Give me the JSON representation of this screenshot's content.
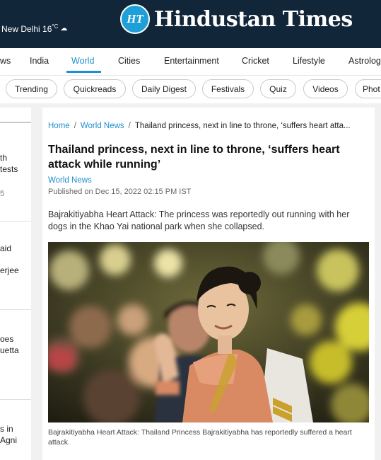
{
  "header": {
    "weather_text": "New Delhi 16",
    "weather_unit": "°C",
    "weather_icon": "cloud-icon",
    "logo_badge": "HT",
    "logo_name": "Hindustan Times",
    "bg_color": "#12263a"
  },
  "nav": {
    "items": [
      "ws",
      "India",
      "World",
      "Cities",
      "Entertainment",
      "Cricket",
      "Lifestyle",
      "Astrolog"
    ],
    "active": "World",
    "accent": "#1e8fd1"
  },
  "pills": [
    "Trending",
    "Quickreads",
    "Daily Digest",
    "Festivals",
    "Quiz",
    "Videos",
    "Phot"
  ],
  "left_column": {
    "fragments": [
      "th",
      "tests",
      "5",
      "aid",
      "erjee",
      "oes",
      "uetta",
      "s in",
      "Agni"
    ]
  },
  "article": {
    "breadcrumb": {
      "home": "Home",
      "section": "World News",
      "current": "Thailand princess, next in line to throne, ‘suffers heart atta..."
    },
    "title": "Thailand princess, next in line to throne, ‘suffers heart attack while running’",
    "section_label": "World News",
    "published": "Published on Dec 15, 2022 02:15 PM IST",
    "summary": "Bajrakitiyabha Heart Attack: The princess was reportedly out running with her dogs in the Khao Yai national park when she collapsed.",
    "caption": "Bajrakitiyabha Heart Attack: Thailand Princess Bajrakitiyabha has reportedly suffered a heart attack."
  }
}
